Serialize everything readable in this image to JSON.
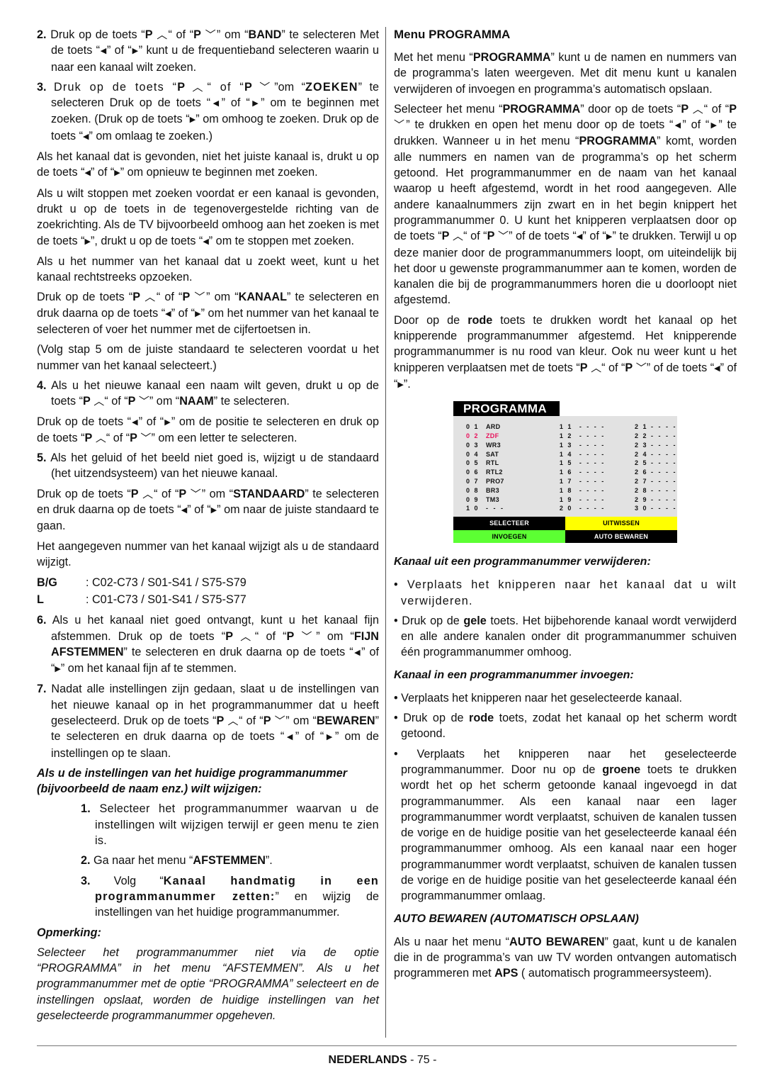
{
  "glyphs": {
    "up": "︿",
    "down": "﹀",
    "left": "◀",
    "right": "▶"
  },
  "left": {
    "step2": {
      "num": "2.",
      "parts": [
        "Druk op de toets “",
        "P",
        "“ of “",
        "P",
        "” om “",
        "BAND",
        "” te selecteren Met de toets “",
        "” of “",
        "” kunt u de frequentieband selecteren waarin u naar een kanaal wilt zoeken."
      ]
    },
    "step3": {
      "num": "3.",
      "parts": [
        "Druk op de toets “",
        "P",
        "“ of “",
        "P",
        "”om “",
        "ZOEKEN",
        "” te selecteren Druk op de toets “",
        "” of “",
        "” om te beginnen met zoeken. (Druk op de toets “",
        "” om omhoog te zoeken. Druk op de toets “",
        "” om omlaag te zoeken.)"
      ]
    },
    "p_not_right": [
      "Als het kanaal dat is gevonden, niet het juiste kanaal is, drukt u op de toets “",
      "” of “",
      "” om opnieuw te beginnen met zoeken."
    ],
    "p_stop": [
      "Als u wilt stoppen met zoeken voordat er een kanaal is gevonden, drukt u op de toets in de tegenovergestelde richting van de zoekrichting. Als de TV bijvoorbeeld omhoog aan het zoeken is met de toets  “",
      "”, drukt u op de toets “",
      "” om te stoppen met zoeken."
    ],
    "p_direct": "Als u het nummer van het kanaal dat u zoekt weet, kunt u het kanaal rechtstreeks opzoeken.",
    "p_kanaal": [
      "Druk op de toets “",
      "P",
      "“ of “",
      "P",
      "” om “",
      "KANAAL",
      "” te selecteren en druk daarna op de toets “",
      "” of “",
      "” om het nummer van het kanaal te selecteren of voer het nummer met de cijfertoetsen in."
    ],
    "p_volg": "(Volg stap 5 om de juiste standaard te selecteren voordat u het nummer van het kanaal selecteert.)",
    "step4": {
      "num": "4.",
      "parts": [
        "Als u het nieuwe kanaal een naam wilt geven, drukt u op de toets “",
        "P",
        "“ of “",
        "P",
        "” om “",
        "NAAM",
        "” te selecteren."
      ]
    },
    "p_positie": [
      "Druk op de toets “",
      "” of “",
      "” om de positie te selecteren en druk op de toets “",
      "P",
      "“ of “",
      "P",
      "” om een letter te selecteren."
    ],
    "step5": {
      "num": "5.",
      "text": "Als het geluid of het beeld niet goed is, wijzigt u de standaard (het uitzendsysteem) van het nieuwe kanaal."
    },
    "p_standaard": [
      "Druk op de toets “",
      "P",
      "“ of “",
      "P",
      "” om “",
      "STANDAARD",
      "” te selecteren en druk daarna op de toets “",
      "” of “",
      "” om naar de juiste standaard te gaan."
    ],
    "p_aangegeven": "Het aangegeven nummer van het kanaal wijzigt als u de standaard wijzigt.",
    "channel_ranges": [
      {
        "key": "B/G",
        "value": ": C02-C73 / S01-S41 / S75-S79"
      },
      {
        "key": "L",
        "value": ": C01-C73 / S01-S41 / S75-S77"
      }
    ],
    "step6": {
      "num": "6.",
      "parts": [
        "Als u het kanaal niet goed ontvangt, kunt u het kanaal fijn afstemmen. Druk op de toets “",
        "P",
        "“ of “",
        "P",
        "” om “",
        "FIJN AFSTEMMEN",
        "” te selecteren en druk daarna op de toets “",
        "” of “",
        "” om het kanaal fijn af te stemmen."
      ]
    },
    "step7": {
      "num": "7.",
      "parts": [
        "Nadat alle instellingen zijn gedaan, slaat u de instellingen van het nieuwe kanaal op in het programmanummer dat u heeft geselecteerd. Druk op de toets “",
        "P",
        "“ of “",
        "P",
        "” om “",
        "BEWAREN",
        "” te selecteren en druk daarna op de toets “",
        "” of “",
        "” om de instellingen op te slaan."
      ]
    },
    "heading_change": "Als u de instellingen van het huidige programmanummer (bijvoorbeeld de naam enz.) wilt wijzigen:",
    "sub1": {
      "num": "1.",
      "text": "Selecteer het programmanummer waarvan u de instellingen wilt wijzigen terwijl er geen menu te zien is."
    },
    "sub2": {
      "num": "2.",
      "parts": [
        "Ga naar het menu “",
        "AFSTEMMEN",
        "”."
      ]
    },
    "sub3": {
      "num": "3.",
      "parts": [
        "Volg “",
        "Kanaal handmatig in een programmanummer zetten:",
        "” en wijzig de instellingen van het huidige programmanummer."
      ]
    },
    "note_label": "Opmerking:",
    "note_text": "Selecteer het programmanummer niet via de optie “PROGRAMMA” in het menu “AFSTEMMEN”. Als u het programmanummer met de optie “PROGRAMMA” selecteert en de instellingen opslaat, worden de huidige instellingen van het geselecteerde programmanummer opgeheven."
  },
  "right": {
    "heading": "Menu PROGRAMMA",
    "p_intro": [
      "Met het menu “",
      "PROGRAMMA",
      "” kunt u de namen en nummers van de programma’s laten weergeven. Met dit menu kunt u kanalen verwijderen of invoegen en programma’s automatisch opslaan."
    ],
    "p_select": [
      "Selecteer het menu “",
      "PROGRAMMA",
      "” door op de toets “",
      "P",
      "“ of “",
      "P",
      "” te drukken en open het menu door op de toets “",
      "” of “",
      "” te drukken. Wanneer u in het menu “",
      "PROGRAMMA",
      "” komt, worden alle nummers en namen van de programma’s op het scherm getoond. Het programmanummer en de naam van het kanaal waarop u heeft afgestemd, wordt in het rood aangegeven. Alle andere kanaalnummers zijn zwart en in het begin knippert het programmanummer 0. U kunt het knipperen verplaatsen door op de toets “",
      "P",
      "“ of “",
      "P",
      "” of de toets “",
      "” of “",
      "” te drukken. Terwijl u op deze manier door de programmanummers loopt, om uiteindelijk bij het door u gewenste programmanummer aan te komen, worden de kanalen die bij de programmanummers horen die u doorloopt niet afgestemd."
    ],
    "p_rode": [
      "Door op de ",
      "rode",
      " toets te drukken wordt het kanaal op het knipperende programmanummer afgestemd. Het knipperende programmanummer is nu rood van kleur. Ook nu weer kunt u het knipperen verplaatsen met de toets “",
      "P",
      "“ of “",
      "P",
      "” of de toets “",
      "” of “",
      "”."
    ],
    "tv_menu": {
      "title": "PROGRAMMA",
      "active_index": 1,
      "active_color": "#e8115b",
      "columns": [
        [
          {
            "num": "01",
            "name": "ARD"
          },
          {
            "num": "02",
            "name": "ZDF"
          },
          {
            "num": "03",
            "name": "WR3"
          },
          {
            "num": "04",
            "name": "SAT"
          },
          {
            "num": "05",
            "name": "RTL"
          },
          {
            "num": "06",
            "name": "RTL2"
          },
          {
            "num": "07",
            "name": "PRO7"
          },
          {
            "num": "08",
            "name": "BR3"
          },
          {
            "num": "09",
            "name": "TM3"
          },
          {
            "num": "10",
            "name": "- - -"
          }
        ],
        [
          {
            "num": "11",
            "name": "- - - -"
          },
          {
            "num": "12",
            "name": "- - - -"
          },
          {
            "num": "13",
            "name": "- - - -"
          },
          {
            "num": "14",
            "name": "- - - -"
          },
          {
            "num": "15",
            "name": "- - - -"
          },
          {
            "num": "16",
            "name": "- - - -"
          },
          {
            "num": "17",
            "name": "- - - -"
          },
          {
            "num": "18",
            "name": "- - - -"
          },
          {
            "num": "19",
            "name": "- - - -"
          },
          {
            "num": "20",
            "name": "- - - -"
          }
        ],
        [
          {
            "num": "21",
            "name": "- - - -"
          },
          {
            "num": "22",
            "name": "- - - -"
          },
          {
            "num": "23",
            "name": "- - - -"
          },
          {
            "num": "24",
            "name": "- - - -"
          },
          {
            "num": "25",
            "name": "- - - -"
          },
          {
            "num": "26",
            "name": "- - - -"
          },
          {
            "num": "27",
            "name": "- - - -"
          },
          {
            "num": "28",
            "name": "- - - -"
          },
          {
            "num": "29",
            "name": "- - - -"
          },
          {
            "num": "30",
            "name": "- - - -"
          }
        ]
      ],
      "buttons": [
        {
          "label": "SELECTEER",
          "color": "#000000"
        },
        {
          "label": "UITWISSEN",
          "color": "#ffff00"
        },
        {
          "label": "INVOEGEN",
          "color": "#5cff33"
        },
        {
          "label": "AUTO BEWAREN",
          "color": "#000000"
        }
      ]
    },
    "heading_remove": "Kanaal uit een programmanummer verwijderen:",
    "remove_bullets": [
      {
        "parts": [
          "Verplaats het knipperen naar het kanaal dat u wilt verwijderen."
        ]
      },
      {
        "parts": [
          "Druk op de ",
          "gele",
          " toets. Het bijbehorende kanaal wordt verwijderd en alle andere kanalen onder dit programmanummer schuiven één programmanummer omhoog."
        ]
      }
    ],
    "heading_insert": "Kanaal in een programmanummer invoegen:",
    "insert_bullets": [
      {
        "parts": [
          "Verplaats het knipperen naar het geselecteerde kanaal."
        ]
      },
      {
        "parts": [
          "Druk op de ",
          "rode",
          " toets, zodat het kanaal op het scherm wordt getoond."
        ]
      },
      {
        "parts": [
          "Verplaats het knipperen naar het geselecteerde programmanummer. Door nu op de ",
          "groene",
          " toets te drukken wordt het op het scherm getoonde kanaal ingevoegd in dat programmanummer. Als een kanaal naar een lager programmanummer wordt verplaatst, schuiven de kanalen tussen de vorige en de huidige positie van het geselecteerde kanaal één programmanummer omhoog. Als een kanaal naar een hoger programmanummer wordt verplaatst, schuiven de kanalen tussen de vorige en de huidige positie van het geselecteerde kanaal één programmanummer omlaag."
        ]
      }
    ],
    "heading_auto": "AUTO BEWAREN (AUTOMATISCH OPSLAAN)",
    "p_auto": [
      "Als u naar het menu “",
      "AUTO BEWAREN",
      "” gaat, kunt u de kanalen die in de programma’s van uw TV worden ontvangen automatisch programmeren met ",
      "APS",
      " ( automatisch programmeersysteem)."
    ]
  },
  "footer": {
    "language": "NEDERLANDS",
    "page": " - 75 -"
  }
}
